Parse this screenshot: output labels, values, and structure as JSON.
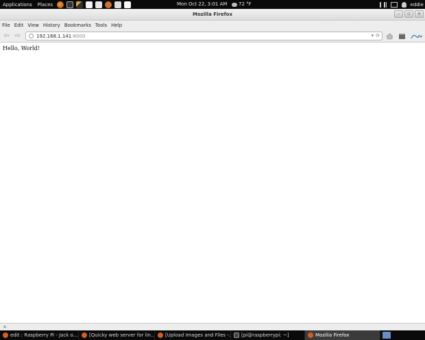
{
  "top_panel": {
    "applications": "Applications",
    "places": "Places",
    "clock": "Mon Oct 22,  3:01 AM",
    "temperature": "72 °F",
    "user": "eddie"
  },
  "window": {
    "title": "Mozilla Firefox",
    "minimize_glyph": "–",
    "maximize_glyph": "▫",
    "close_glyph": "×"
  },
  "menubar": [
    "File",
    "Edit",
    "View",
    "History",
    "Bookmarks",
    "Tools",
    "Help"
  ],
  "navbar": {
    "back_glyph": "⇦",
    "forward_glyph": "⇨",
    "url_host": "192.168.1.141",
    "url_port": ":8000",
    "dropdown_glyph": "▾",
    "reload_glyph": "⟳"
  },
  "content": {
    "text": "Hello, World!"
  },
  "statusbar": {
    "close_glyph": "×"
  },
  "taskbar": [
    "edit : Raspberry Pi - Jack o...",
    "[Quicky web server for lin...",
    "[Upload Images and Files -...",
    "[pi@raspberrypi: ~]",
    "Mozilla Firefox"
  ],
  "colors": {
    "panel_bg": "#0a0a0a",
    "chrome_bg": "#ededed",
    "url_port": "#8a8a8a"
  }
}
